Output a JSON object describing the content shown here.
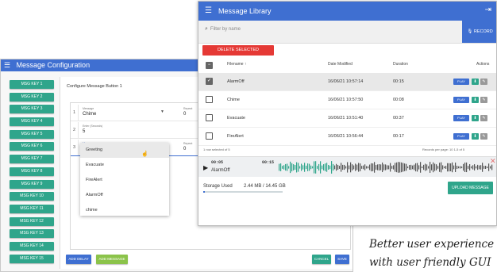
{
  "config": {
    "title": "Message Configuration",
    "page_title": "Configure Message Button 1",
    "msg_keys": [
      "MSG KEY 1",
      "MSG KEY 2",
      "MSG KEY 3",
      "MSG KEY 4",
      "MSG KEY 5",
      "MSG KEY 6",
      "MSG KEY 7",
      "MSG KEY 8",
      "MSG KEY 9",
      "MSG KEY 10",
      "MSG KEY 11",
      "MSG KEY 12",
      "MSG KEY 13",
      "MSG KEY 14",
      "MSG KEY 15"
    ],
    "rows": [
      {
        "num": "1",
        "label": "Message",
        "value": "Chime",
        "repeat_label": "Repeat",
        "repeat_value": "0"
      },
      {
        "num": "2",
        "label": "Enter (Seconds)",
        "value": "5",
        "repeat_label": "",
        "repeat_value": ""
      },
      {
        "num": "3",
        "label": "Message",
        "value": "",
        "repeat_label": "Repeat",
        "repeat_value": "0"
      }
    ],
    "dropdown_options": [
      "Greeting",
      "Evacuate",
      "FireAlert",
      "AlarmOff",
      "chime"
    ],
    "add_delay": "ADD DELAY",
    "add_message": "ADD MESSAGE",
    "cancel": "CANCEL",
    "save": "SAVE",
    "colors": {
      "primary": "#3f6fd1",
      "key": "#2fa58b",
      "add_message": "#8bc34a"
    }
  },
  "library": {
    "title": "Message Library",
    "search_placeholder": "Filter by name",
    "record": "RECORD",
    "delete_selected": "DELETE SELECTED",
    "columns": {
      "filename": "Filename ↑",
      "modified": "Date Modified",
      "duration": "Duration",
      "actions": "Actions"
    },
    "rows": [
      {
        "name": "AlarmOff",
        "modified": "16/06/21 10:57:14",
        "duration": "00:15",
        "selected": true
      },
      {
        "name": "Chime",
        "modified": "16/06/21 10:57:50",
        "duration": "00:08",
        "selected": false
      },
      {
        "name": "Evacuate",
        "modified": "16/06/21 10:51:40",
        "duration": "00:37",
        "selected": false
      },
      {
        "name": "FireAlert",
        "modified": "16/06/21 10:56:44",
        "duration": "00:17",
        "selected": false
      }
    ],
    "play": "PLAY",
    "pager": {
      "left": "1 row selected of 5",
      "right": "Records per page:  10      1-5 of 5"
    },
    "player": {
      "current": "00:05",
      "total": "00:15",
      "track": "AlarmOff"
    },
    "storage_label": "Storage Used",
    "storage_value": "2.44 MB / 14.45 GB",
    "storage_fraction": 0.02,
    "upload": "UPLOAD MESSAGE",
    "colors": {
      "primary": "#3f6fd1",
      "delete": "#e53935",
      "upload": "#2fa58b",
      "wave": "#2fa58b"
    }
  },
  "caption": {
    "line1": "Better user experience",
    "line2": "with user friendly GUI"
  }
}
